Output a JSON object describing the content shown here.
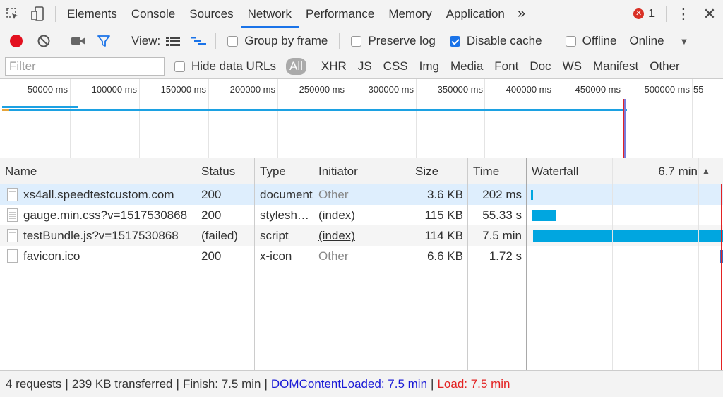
{
  "tabs": [
    "Elements",
    "Console",
    "Sources",
    "Network",
    "Performance",
    "Memory",
    "Application"
  ],
  "active_tab": "Network",
  "overflow_label": "»",
  "error_count": "1",
  "toolbar": {
    "view_label": "View:",
    "group_by_frame": "Group by frame",
    "preserve_log": "Preserve log",
    "disable_cache": "Disable cache",
    "disable_cache_checked": true,
    "offline": "Offline",
    "throttling": "Online"
  },
  "filterbar": {
    "placeholder": "Filter",
    "hide_data_urls": "Hide data URLs",
    "types": [
      "All",
      "XHR",
      "JS",
      "CSS",
      "Img",
      "Media",
      "Font",
      "Doc",
      "WS",
      "Manifest",
      "Other"
    ]
  },
  "overview": {
    "ticks": [
      "50000 ms",
      "100000 ms",
      "150000 ms",
      "200000 ms",
      "250000 ms",
      "300000 ms",
      "350000 ms",
      "400000 ms",
      "450000 ms",
      "500000 ms",
      "55"
    ]
  },
  "table": {
    "columns": {
      "name": "Name",
      "status": "Status",
      "type": "Type",
      "initiator": "Initiator",
      "size": "Size",
      "time": "Time",
      "waterfall": "Waterfall",
      "waterfall_scale": "6.7 min"
    },
    "rows": [
      {
        "name": "xs4all.speedtestcustom.com",
        "status": "200",
        "type": "document",
        "initiator": "Other",
        "size": "3.6 KB",
        "time": "202 ms"
      },
      {
        "name": "gauge.min.css?v=1517530868",
        "status": "200",
        "type": "stylesheet",
        "initiator": "(index)",
        "size": "115 KB",
        "time": "55.33 s"
      },
      {
        "name": "testBundle.js?v=1517530868",
        "status": "(failed)",
        "type": "script",
        "initiator": "(index)",
        "size": "114 KB",
        "time": "7.5 min"
      },
      {
        "name": "favicon.ico",
        "status": "200",
        "type": "x-icon",
        "initiator": "Other",
        "size": "6.6 KB",
        "time": "1.72 s"
      }
    ]
  },
  "status": {
    "requests": "4 requests",
    "transferred": "239 KB transferred",
    "finish": "Finish: 7.5 min",
    "dom_content_loaded": "DOMContentLoaded: 7.5 min",
    "load": "Load: 7.5 min"
  },
  "colors": {
    "accent": "#1a73e8",
    "record": "#e3101f",
    "waterfall_bar": "#00a6e0",
    "dom_loaded": "#1a1ad6",
    "load": "#e32222"
  }
}
